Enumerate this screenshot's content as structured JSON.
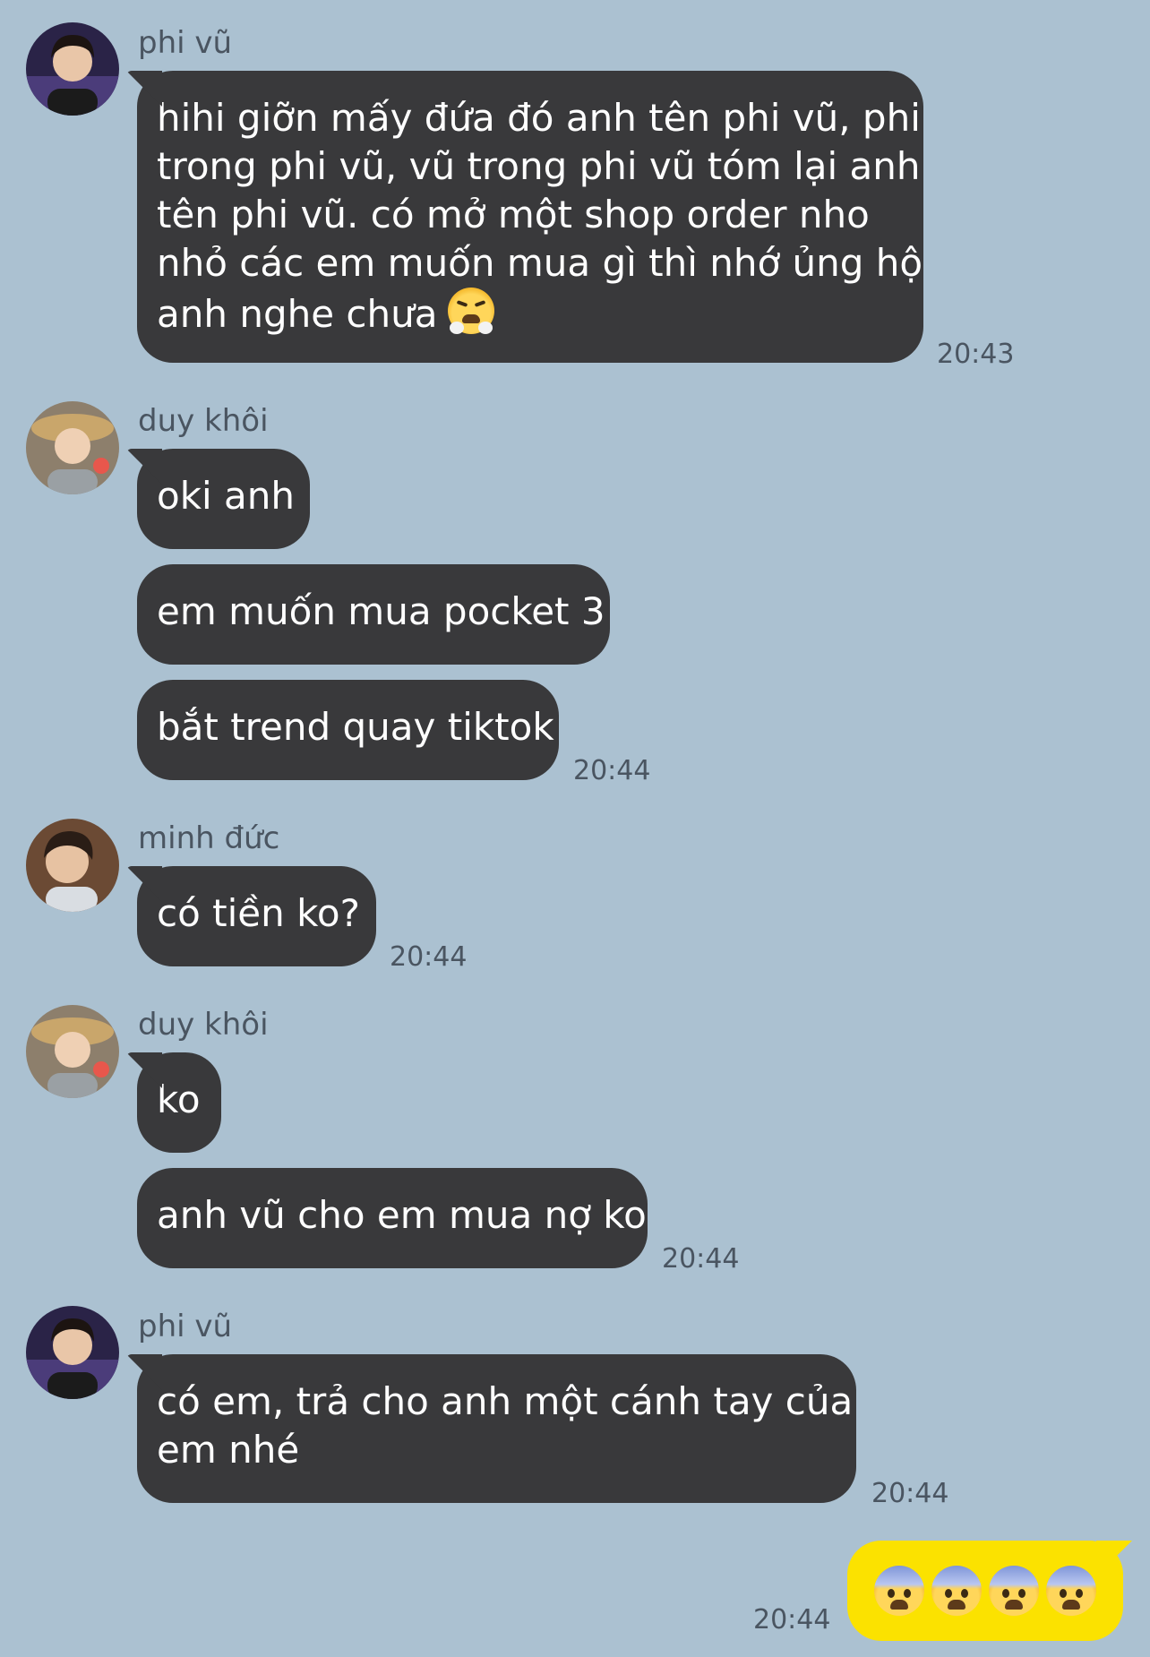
{
  "messages": [
    {
      "sender": "phi vũ",
      "avatar": "avatar-phi-vu",
      "bubbles": [
        {
          "lines": [
            "hihi giỡn mấy đứa đó anh tên phi vũ, phi",
            "trong phi vũ, vũ trong phi vũ tóm lại anh",
            "tên phi vũ. có mở một shop order nho",
            "nhỏ các em muốn mua gì thì nhớ ủng hộ",
            "anh nghe chưa"
          ],
          "emoji": "face-with-steam-from-nose"
        }
      ],
      "time": "20:43"
    },
    {
      "sender": "duy khôi",
      "avatar": "avatar-duy-khoi",
      "bubbles": [
        {
          "text": "oki anh"
        },
        {
          "text": "em muốn mua pocket 3"
        },
        {
          "text": "bắt trend quay tiktok"
        }
      ],
      "time": "20:44"
    },
    {
      "sender": "minh đức",
      "avatar": "avatar-minh-duc",
      "bubbles": [
        {
          "text": "có tiền ko?"
        }
      ],
      "time": "20:44"
    },
    {
      "sender": "duy khôi",
      "avatar": "avatar-duy-khoi",
      "bubbles": [
        {
          "text": "ko"
        },
        {
          "text": "anh vũ cho em mua nợ ko"
        }
      ],
      "time": "20:44"
    },
    {
      "sender": "phi vũ",
      "avatar": "avatar-phi-vu",
      "bubbles": [
        {
          "lines": [
            "có em, trả cho anh một cánh tay của",
            "em nhé"
          ]
        }
      ],
      "time": "20:44"
    }
  ],
  "my_message": {
    "emoji": "fearful-face",
    "emoji_count": 4,
    "time": "20:44"
  },
  "colors": {
    "background": "#abc1d1",
    "incoming_bubble": "#39393b",
    "outgoing_bubble": "#fbe200",
    "meta_text": "#4a5561"
  }
}
